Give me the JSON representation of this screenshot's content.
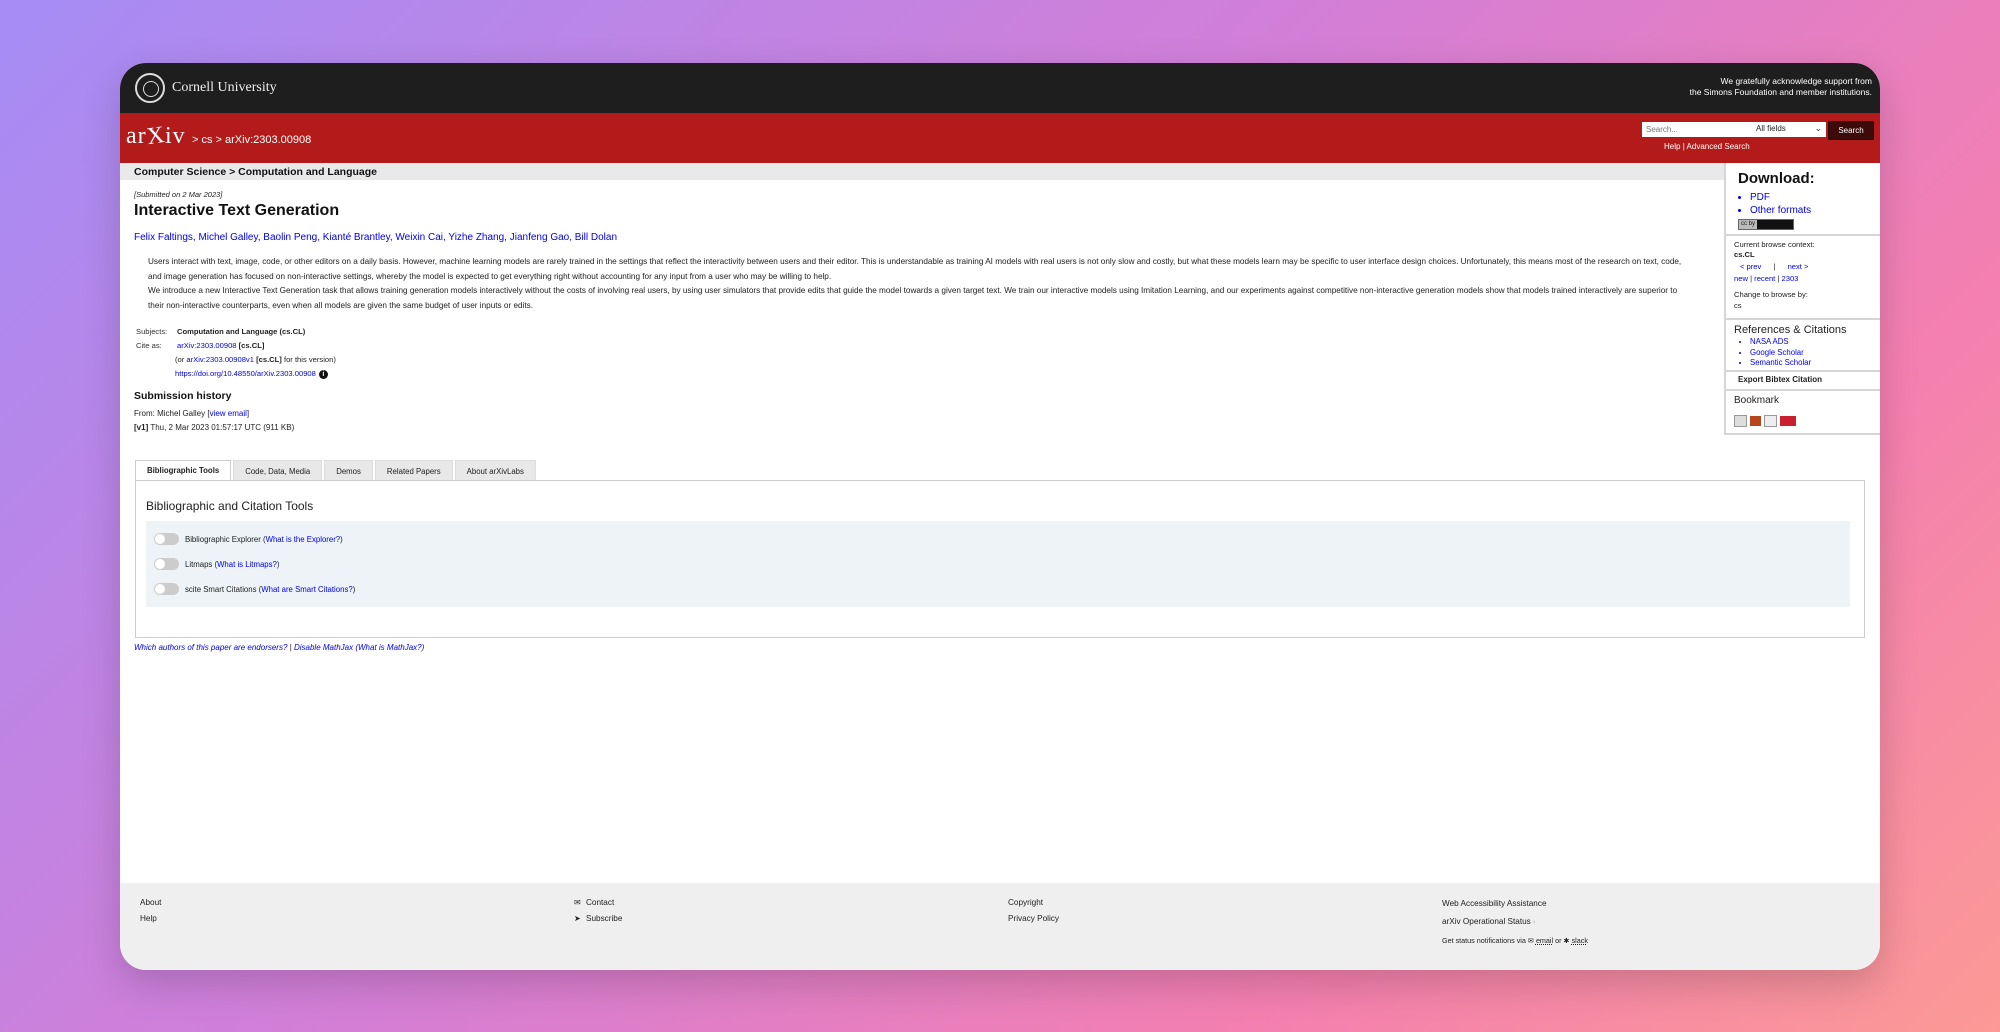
{
  "header": {
    "cornell_name": "Cornell University",
    "ack_line1": "We gratefully acknowledge support from",
    "ack_line2": "the Simons Foundation and member institutions.",
    "arxiv_logo_a": "ar",
    "arxiv_logo_x": "X",
    "arxiv_logo_b": "iv",
    "breadcrumb": "> cs > arXiv:2303.00908",
    "search_placeholder": "Search...",
    "search_field": "All fields",
    "search_button": "Search",
    "help": "Help",
    "advanced_search": "Advanced Search",
    "help_sep": "|"
  },
  "subheader": "Computer Science > Computation and Language",
  "paper": {
    "submitted": "[Submitted on 2 Mar 2023]",
    "title": "Interactive Text Generation",
    "authors": "Felix Faltings, Michel Galley, Baolin Peng, Kianté Brantley, Weixin Cai, Yizhe Zhang, Jianfeng Gao, Bill Dolan",
    "abstract_p1": "Users interact with text, image, code, or other editors on a daily basis. However, machine learning models are rarely trained in the settings that reflect the interactivity between users and their editor. This is understandable as training AI models with real users is not only slow and costly, but what these models learn may be specific to user interface design choices. Unfortunately, this means most of the research on text, code, and image generation has focused on non-interactive settings, whereby the model is expected to get everything right without accounting for any input from a user who may be willing to help.",
    "abstract_p2": "We introduce a new Interactive Text Generation task that allows training generation models interactively without the costs of involving real users, by using user simulators that provide edits that guide the model towards a given target text. We train our interactive models using Imitation Learning, and our experiments against competitive non-interactive generation models show that models trained interactively are superior to their non-interactive counterparts, even when all models are given the same budget of user inputs or edits.",
    "subjects_label": "Subjects:",
    "subjects": "Computation and Language (cs.CL)",
    "cite_label": "Cite as:",
    "cite_id": "arXiv:2303.00908",
    "cite_cat": "[cs.CL]",
    "cite_or": "(or",
    "cite_v1": "arXiv:2303.00908v1",
    "cite_v1_suffix": "for this version)",
    "doi": "https://doi.org/10.48550/arXiv.2303.00908",
    "info_glyph": "i",
    "history_title": "Submission history",
    "history_from": "From: Michel Galley [",
    "history_view_email": "view email",
    "history_close": "]",
    "history_v1": "[v1]",
    "history_date": "Thu, 2 Mar 2023 01:57:17 UTC (911 KB)"
  },
  "tabs": [
    "Bibliographic Tools",
    "Code, Data, Media",
    "Demos",
    "Related Papers",
    "About arXivLabs"
  ],
  "tools": {
    "panel_title": "Bibliographic and Citation Tools",
    "items": [
      {
        "label": "Bibliographic Explorer (",
        "link": "What is the Explorer?",
        "end": ")"
      },
      {
        "label": "Litmaps (",
        "link": "What is Litmaps?",
        "end": ")"
      },
      {
        "label": "scite Smart Citations (",
        "link": "What are Smart Citations?",
        "end": ")"
      }
    ]
  },
  "footnote": {
    "endorsers": "Which authors of this paper are endorsers?",
    "sep": "|",
    "mathjax": "Disable MathJax",
    "mathjax_what": "(What is MathJax?)"
  },
  "sidebar": {
    "download_title": "Download:",
    "download_links": [
      "PDF",
      "Other formats"
    ],
    "license_badge": "cc by",
    "browse_context_label": "Current browse context:",
    "browse_context": "cs.CL",
    "prev": "< prev",
    "next": "next >",
    "nav_sep": "|",
    "new": "new",
    "recent": "recent",
    "month": "2303",
    "change_browse": "Change to browse by:",
    "browse_cs": "cs",
    "refs_title": "References & Citations",
    "refs_links": [
      "NASA ADS",
      "Google Scholar",
      "Semantic Scholar"
    ],
    "export_bibtex": "Export Bibtex Citation",
    "bookmark_title": "Bookmark"
  },
  "footer": {
    "about": "About",
    "help": "Help",
    "contact": "Contact",
    "subscribe": "Subscribe",
    "copyright": "Copyright",
    "privacy": "Privacy Policy",
    "accessibility": "Web Accessibility Assistance",
    "status": "arXiv Operational Status",
    "notify": "Get status notifications via",
    "email": "email",
    "or": "or",
    "slack": "slack"
  },
  "colors": {
    "cornell_bar": "#1e1e1e",
    "arxiv_red": "#b31b1b",
    "link": "#0000ee"
  }
}
